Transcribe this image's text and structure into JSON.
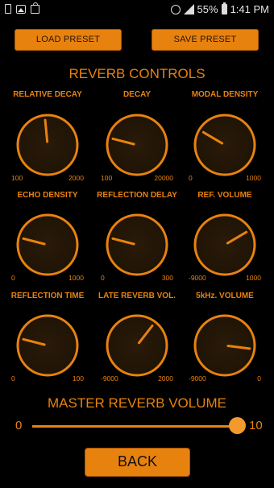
{
  "status_bar": {
    "battery_percent": "55%",
    "time": "1:41 PM",
    "icons": [
      "phone-icon",
      "image-icon",
      "bag-icon",
      "alarm-icon",
      "signal-icon",
      "battery-icon"
    ]
  },
  "buttons": {
    "load_preset": "LOAD PRESET",
    "save_preset": "SAVE PRESET",
    "back": "BACK"
  },
  "title": "REVERB CONTROLS",
  "knobs": [
    {
      "id": "relative-decay",
      "label": "RELATIVE DECAY",
      "min": "100",
      "max": "2000",
      "value_fraction": 0.48
    },
    {
      "id": "decay",
      "label": "DECAY",
      "min": "100",
      "max": "20000",
      "value_fraction": 0.22
    },
    {
      "id": "modal-density",
      "label": "MODAL DENSITY",
      "min": "0",
      "max": "1000",
      "value_fraction": 0.28
    },
    {
      "id": "echo-density",
      "label": "ECHO DENSITY",
      "min": "0",
      "max": "1000",
      "value_fraction": 0.22
    },
    {
      "id": "reflection-delay",
      "label": "REFLECTION DELAY",
      "min": "0",
      "max": "300",
      "value_fraction": 0.22
    },
    {
      "id": "ref-volume",
      "label": "REF. VOLUME",
      "min": "-9000",
      "max": "1000",
      "value_fraction": 0.72
    },
    {
      "id": "reflection-time",
      "label": "REFLECTION TIME",
      "min": "0",
      "max": "100",
      "value_fraction": 0.22
    },
    {
      "id": "late-reverb-vol",
      "label": "LATE REVERB VOL.",
      "min": "-9000",
      "max": "2000",
      "value_fraction": 0.64
    },
    {
      "id": "5khz-volume",
      "label": "5kHz. VOLUME",
      "min": "-9000",
      "max": "0",
      "value_fraction": 0.86
    }
  ],
  "master": {
    "title": "MASTER REVERB VOLUME",
    "min": "0",
    "max": "10",
    "value": 10
  },
  "colors": {
    "accent": "#e8820f",
    "background": "#000000",
    "knob_fill": "#1f1406"
  }
}
